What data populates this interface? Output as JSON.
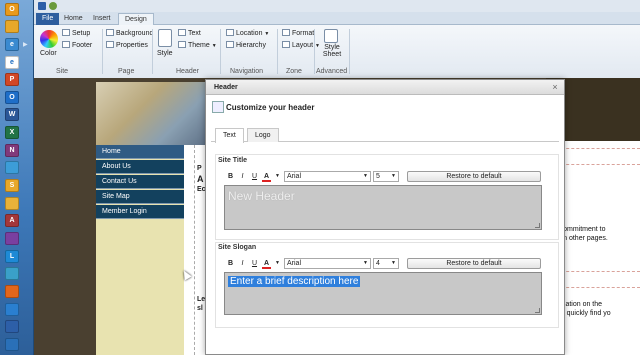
{
  "ribbon": {
    "tabs": [
      "File",
      "Home",
      "Insert",
      "Design"
    ],
    "active_tab": "Design",
    "groups": {
      "site": {
        "label": "Site",
        "color_label": "Color",
        "setup": "Setup",
        "footer": "Footer"
      },
      "page": {
        "label": "Page",
        "background": "Background",
        "properties": "Properties"
      },
      "header": {
        "label": "Header",
        "style": "Style",
        "text": "Text",
        "theme": "Theme"
      },
      "navigation": {
        "label": "Navigation",
        "location": "Location",
        "hierarchy": "Hierarchy"
      },
      "zone": {
        "label": "Zone",
        "format": "Format",
        "layout": "Layout"
      },
      "advanced": {
        "label": "Advanced",
        "style_sheet": "Style\nSheet"
      }
    }
  },
  "site": {
    "nav": [
      "Home",
      "About Us",
      "Contact Us",
      "Site Map",
      "Member Login"
    ],
    "right_text": {
      "line1": "and commitment to",
      "line2": "find on other pages.",
      "line3": "information on the",
      "line4": "site to quickly find yo"
    },
    "edge_letters": [
      "P",
      "A",
      "Ec",
      "Le",
      "sl"
    ]
  },
  "dialog": {
    "title": "Header",
    "close": "×",
    "subtitle": "Customize your header",
    "tabs": [
      "Text",
      "Logo"
    ],
    "active_tab": "Text",
    "site_title": {
      "label": "Site Title",
      "font": "Arial",
      "size": "5",
      "restore": "Restore to default",
      "value": "New Header"
    },
    "site_slogan": {
      "label": "Site Slogan",
      "font": "Arial",
      "size": "4",
      "restore": "Restore to default",
      "value": "Enter a brief description here"
    },
    "format": {
      "bold": "B",
      "italic": "I",
      "underline": "U",
      "color": "A"
    }
  },
  "colors": {
    "taskbar": "#3d78b8",
    "nav_home": "#2f5b84",
    "nav_sub": "#13415e",
    "selection": "#2f7fdc"
  }
}
